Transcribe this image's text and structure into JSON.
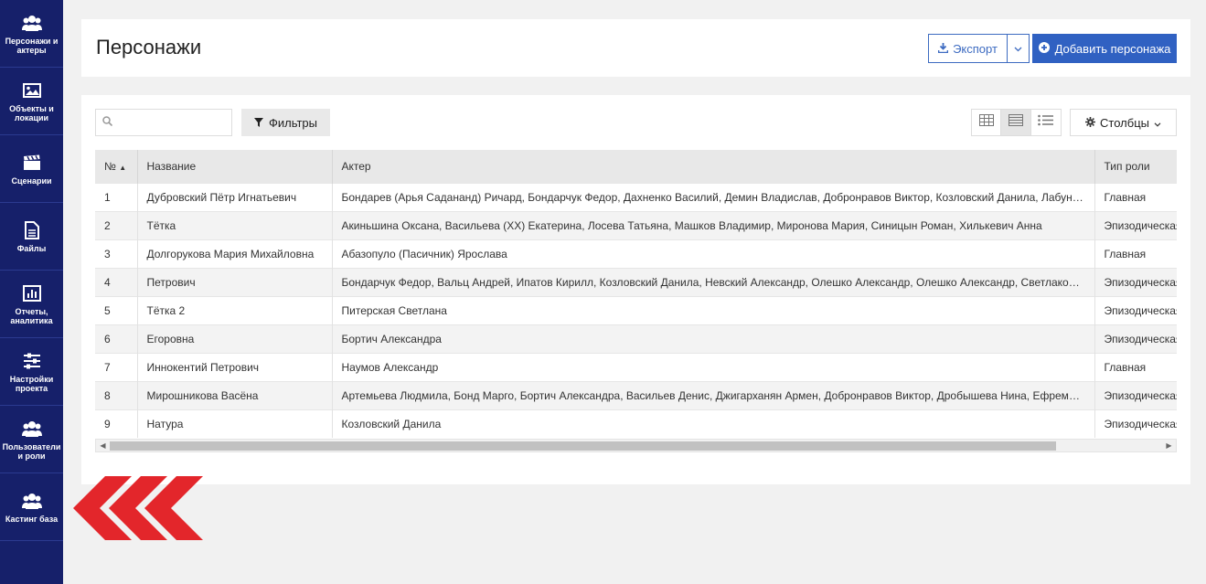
{
  "sidebar": {
    "items": [
      {
        "label": "Персонажи и актеры",
        "icon": "users-icon"
      },
      {
        "label": "Объекты и локации",
        "icon": "image-icon"
      },
      {
        "label": "Сценарии",
        "icon": "clapperboard-icon"
      },
      {
        "label": "Файлы",
        "icon": "file-icon"
      },
      {
        "label": "Отчеты, аналитика",
        "icon": "bar-chart-icon"
      },
      {
        "label": "Настройки проекта",
        "icon": "sliders-icon"
      },
      {
        "label": "Пользователи и роли",
        "icon": "users-icon"
      },
      {
        "label": "Кастинг база",
        "icon": "users-icon"
      }
    ]
  },
  "header": {
    "title": "Персонажи",
    "export_label": "Экспорт",
    "add_label": "Добавить персонажа"
  },
  "toolbar": {
    "search_placeholder": "",
    "filter_label": "Фильтры",
    "columns_label": "Столбцы"
  },
  "table": {
    "columns": [
      "№",
      "Название",
      "Актер",
      "Тип роли"
    ],
    "sort_column": "№",
    "rows": [
      {
        "num": "1",
        "name": "Дубровский Пётр Игнатьевич",
        "actor": "Бондарев (Арья Садананд) Ричард, Бондарчук Федор, Дахненко Василий, Демин Владислав, Добронравов Виктор, Козловский Данила, Лабунский",
        "role": "Главная"
      },
      {
        "num": "2",
        "name": "Тётка",
        "actor": "Акиньшина Оксана, Васильева (XX) Екатерина, Лосева Татьяна, Машков Владимир, Миронова Мария, Синицын Роман, Хилькевич Анна",
        "role": "Эпизодическая"
      },
      {
        "num": "3",
        "name": "Долгорукова Мария Михайловна",
        "actor": "Абазопуло (Пасичник) Ярослава",
        "role": "Главная"
      },
      {
        "num": "4",
        "name": "Петрович",
        "actor": "Бондарчук Федор, Вальц Андрей, Ипатов Кирилл, Козловский Данила, Невский Александр, Олешко Александр, Олешко Александр, Светлаков Сергей",
        "role": "Эпизодическая"
      },
      {
        "num": "5",
        "name": "Тётка 2",
        "actor": "Питерская Светлана",
        "role": "Эпизодическая"
      },
      {
        "num": "6",
        "name": "Егоровна",
        "actor": "Бортич Александра",
        "role": "Эпизодическая"
      },
      {
        "num": "7",
        "name": "Иннокентий Петрович",
        "actor": "Наумов Александр",
        "role": "Главная"
      },
      {
        "num": "8",
        "name": "Мирошникова Васёна",
        "actor": "Артемьева Людмила, Бонд Марго, Бортич Александра, Васильев Денис, Джигарханян Армен, Добронравов Виктор, Дробышева Нина, Ефремов Михаил",
        "role": "Эпизодическая"
      },
      {
        "num": "9",
        "name": "Натура",
        "actor": "Козловский Данила",
        "role": "Эпизодическая"
      }
    ]
  },
  "colors": {
    "sidebar_bg": "#16206a",
    "primary": "#3061c2",
    "logo_red": "#e3262b"
  }
}
